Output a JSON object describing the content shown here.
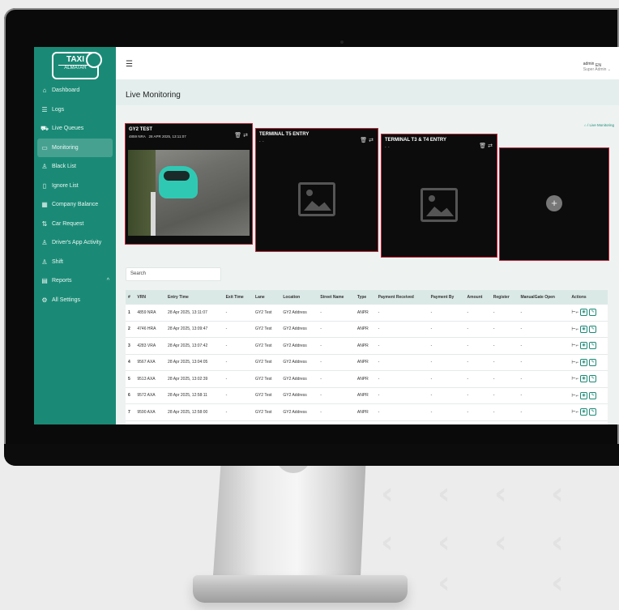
{
  "brand": {
    "logo_text": "TAXI",
    "logo_sub": "ALMATAR"
  },
  "sidebar": {
    "items": [
      {
        "label": "Dashboard",
        "icon": "home-icon"
      },
      {
        "label": "Logs",
        "icon": "list-icon"
      },
      {
        "label": "Live Queues",
        "icon": "car-icon"
      },
      {
        "label": "Monitoring",
        "icon": "monitor-icon",
        "active": true
      },
      {
        "label": "Black List",
        "icon": "user-icon"
      },
      {
        "label": "Ignore List",
        "icon": "bookmark-icon"
      },
      {
        "label": "Company Balance",
        "icon": "calculator-icon"
      },
      {
        "label": "Car Request",
        "icon": "swap-icon"
      },
      {
        "label": "Driver's App Activity",
        "icon": "user-plus-icon"
      },
      {
        "label": "Shift",
        "icon": "user-plus-icon"
      },
      {
        "label": "Reports",
        "icon": "clipboard-icon",
        "caret": "^"
      },
      {
        "label": "All Settings",
        "icon": "gear-icon"
      }
    ]
  },
  "header": {
    "title": "Live Monitoring",
    "lang": "EN",
    "user_name": "admin",
    "user_role": "Super Admin ⌄",
    "breadcrumb": "/ Live Monitoring"
  },
  "cameras": [
    {
      "name": "GY2 TEST",
      "plate": "4859 NRA",
      "time": "28 APR 2025, 13:11:07"
    },
    {
      "name": "TERMINAL T5 ENTRY",
      "plate": "-",
      "time": "-"
    },
    {
      "name": "TERMINAL T3 & T4 ENTRY",
      "plate": "-",
      "time": "-"
    }
  ],
  "search": {
    "placeholder": "Search"
  },
  "table": {
    "columns": [
      "#",
      "VRN",
      "Entry Time",
      "Exit Time",
      "Lane",
      "Location",
      "Street Name",
      "Type",
      "Payment Received",
      "Payment By",
      "Amount",
      "Register",
      "ManualGate Open",
      "Actions"
    ],
    "rows": [
      [
        "1",
        "4859 NRA",
        "28 Apr 2025, 13:11:07",
        "-",
        "GY2 Test",
        "GY2 Address",
        "-",
        "ANPR",
        "-",
        "-",
        "-",
        "-",
        "-"
      ],
      [
        "2",
        "4746 HRA",
        "28 Apr 2025, 13:09:47",
        "-",
        "GY2 Test",
        "GY2 Address",
        "-",
        "ANPR",
        "-",
        "-",
        "-",
        "-",
        "-"
      ],
      [
        "3",
        "4283 VRA",
        "28 Apr 2025, 13:07:42",
        "-",
        "GY2 Test",
        "GY2 Address",
        "-",
        "ANPR",
        "-",
        "-",
        "-",
        "-",
        "-"
      ],
      [
        "4",
        "9567 AXA",
        "28 Apr 2025, 13:04:05",
        "-",
        "GY2 Test",
        "GY2 Address",
        "-",
        "ANPR",
        "-",
        "-",
        "-",
        "-",
        "-"
      ],
      [
        "5",
        "9513 AXA",
        "28 Apr 2025, 13:02:39",
        "-",
        "GY2 Test",
        "GY2 Address",
        "-",
        "ANPR",
        "-",
        "-",
        "-",
        "-",
        "-"
      ],
      [
        "6",
        "9572 AXA",
        "28 Apr 2025, 12:58:11",
        "-",
        "GY2 Test",
        "GY2 Address",
        "-",
        "ANPR",
        "-",
        "-",
        "-",
        "-",
        "-"
      ],
      [
        "7",
        "9590 AXA",
        "28 Apr 2025, 12:58:00",
        "-",
        "GY2 Test",
        "GY2 Address",
        "-",
        "ANPR",
        "-",
        "-",
        "-",
        "-",
        "-"
      ]
    ]
  },
  "colors": {
    "accent": "#1a8a76",
    "tile_border": "#c0283a",
    "header_bg": "#dbe9e6"
  }
}
